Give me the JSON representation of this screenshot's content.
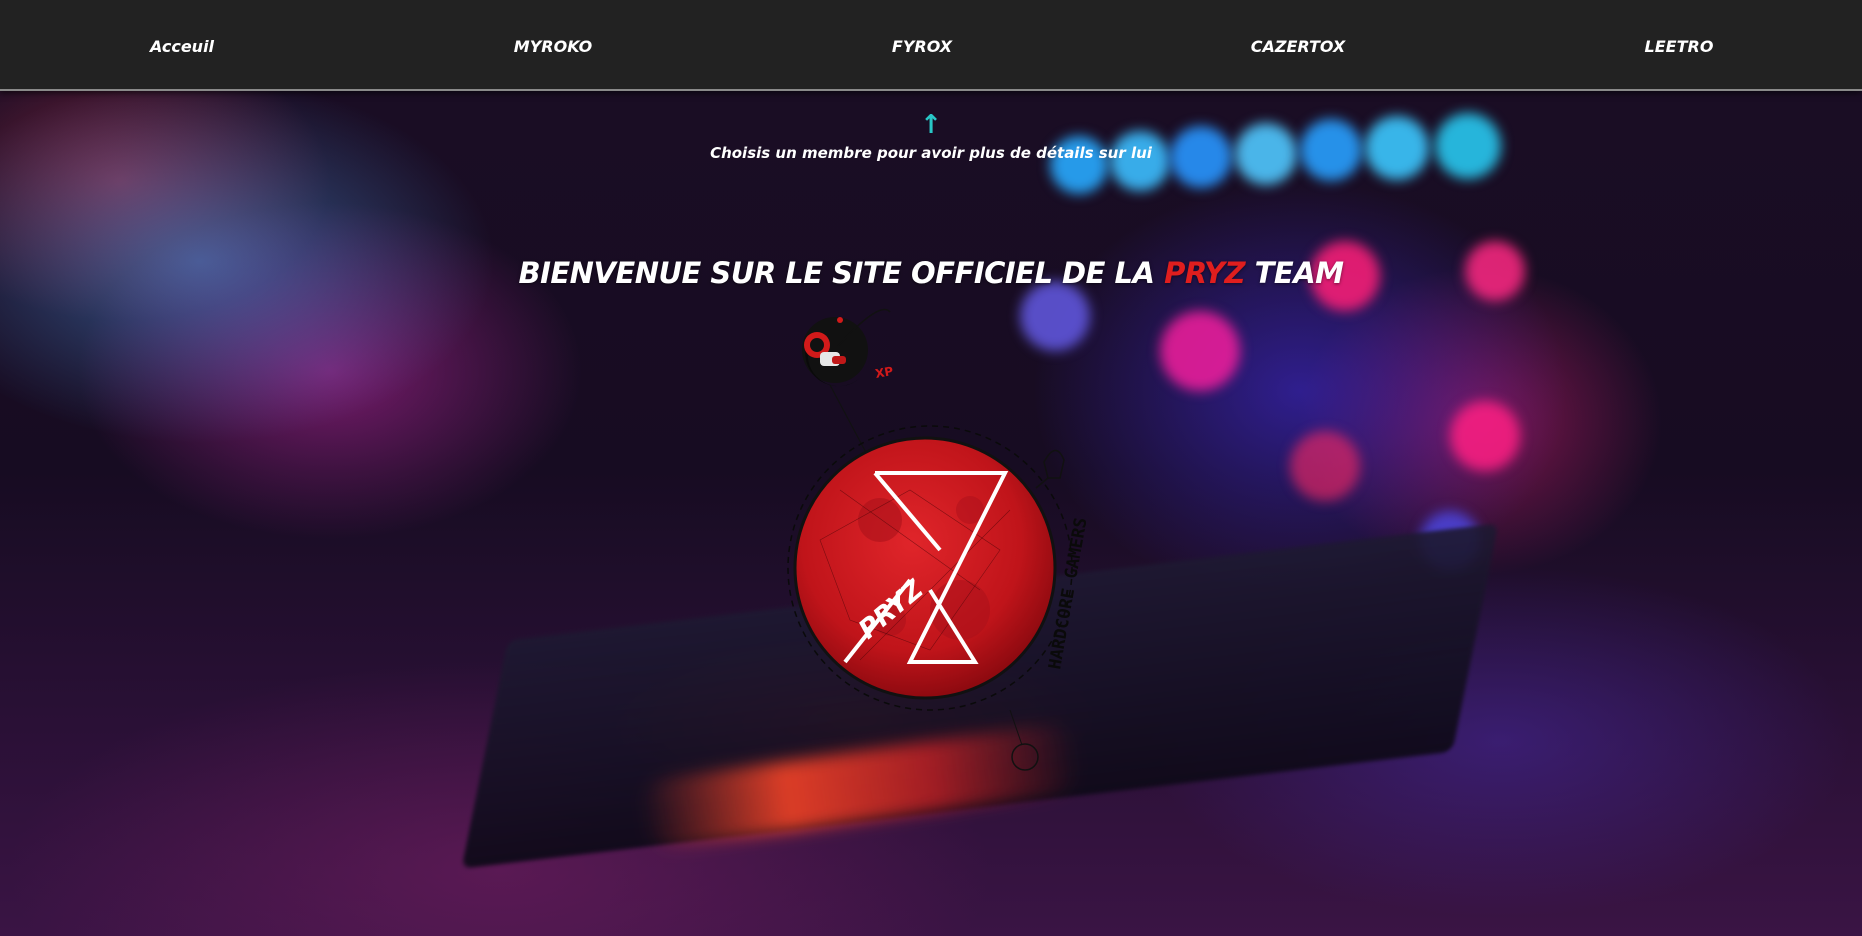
{
  "nav": {
    "items": [
      {
        "label": "Acceuil"
      },
      {
        "label": "MYROKO"
      },
      {
        "label": "FYROX"
      },
      {
        "label": "CAZERTOX"
      },
      {
        "label": "LEETRO"
      }
    ]
  },
  "hero": {
    "hint_icon": "arrow-up-icon",
    "hint_text": "Choisis un membre pour avoir plus de détails sur lui",
    "title_before": "BIENVENUE SUR LE SITE OFFICIEL DE LA ",
    "title_accent": "PRYZ",
    "title_after": " TEAM"
  },
  "logo": {
    "emblem_text": "PRYZ",
    "badge_text": "XP",
    "ring_text": "HARDCORE GAMERS"
  },
  "colors": {
    "navbar_bg": "#222222",
    "accent_red": "#e01e1e",
    "hint_arrow": "#29c7c7",
    "moon_red": "#c0141a"
  }
}
